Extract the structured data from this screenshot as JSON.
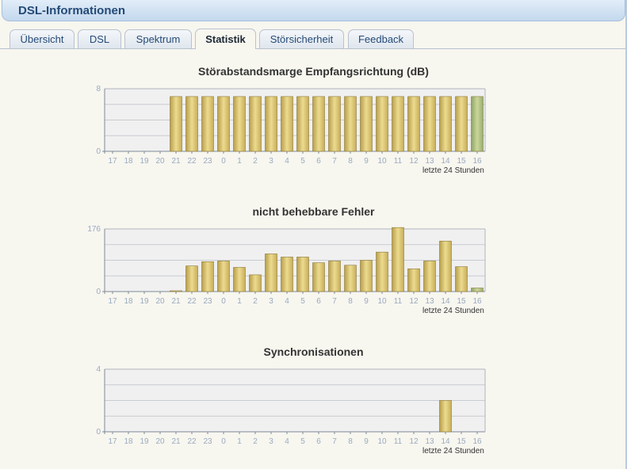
{
  "window": {
    "title": "DSL-Informationen"
  },
  "tabs": [
    {
      "label": "Übersicht",
      "active": false
    },
    {
      "label": "DSL",
      "active": false
    },
    {
      "label": "Spektrum",
      "active": false
    },
    {
      "label": "Statistik",
      "active": true
    },
    {
      "label": "Störsicherheit",
      "active": false
    },
    {
      "label": "Feedback",
      "active": false
    }
  ],
  "colors": {
    "bar": "#d8c166",
    "bar_last": "#a8b878",
    "axis_text": "#9aabc0",
    "plot_bg": "#f0f0f0",
    "grid": "#c8cbd2"
  },
  "chart_data": [
    {
      "type": "bar",
      "title": "Störabstandsmarge Empfangsrichtung (dB)",
      "categories": [
        "17",
        "18",
        "19",
        "20",
        "21",
        "22",
        "23",
        "0",
        "1",
        "2",
        "3",
        "4",
        "5",
        "6",
        "7",
        "8",
        "9",
        "10",
        "11",
        "12",
        "13",
        "14",
        "15",
        "16"
      ],
      "values": [
        0,
        0,
        0,
        0,
        7,
        7,
        7,
        7,
        7,
        7,
        7,
        7,
        7,
        7,
        7,
        7,
        7,
        7,
        7,
        7,
        7,
        7,
        7,
        7
      ],
      "ylim": [
        0,
        8
      ],
      "yticks": [
        "8",
        "0"
      ],
      "caption": "letzte 24 Stunden",
      "last_highlighted": true
    },
    {
      "type": "bar",
      "title": "nicht behebbare Fehler",
      "categories": [
        "17",
        "18",
        "19",
        "20",
        "21",
        "22",
        "23",
        "0",
        "1",
        "2",
        "3",
        "4",
        "5",
        "6",
        "7",
        "8",
        "9",
        "10",
        "11",
        "12",
        "13",
        "14",
        "15",
        "16"
      ],
      "values": [
        0,
        0,
        0,
        0,
        2,
        72,
        84,
        86,
        68,
        47,
        106,
        97,
        97,
        81,
        86,
        74,
        88,
        111,
        180,
        64,
        86,
        142,
        70,
        10
      ],
      "ylim": [
        0,
        176
      ],
      "yticks": [
        "176",
        "0"
      ],
      "caption": "letzte 24 Stunden",
      "last_highlighted": true
    },
    {
      "type": "bar",
      "title": "Synchronisationen",
      "categories": [
        "17",
        "18",
        "19",
        "20",
        "21",
        "22",
        "23",
        "0",
        "1",
        "2",
        "3",
        "4",
        "5",
        "6",
        "7",
        "8",
        "9",
        "10",
        "11",
        "12",
        "13",
        "14",
        "15",
        "16"
      ],
      "values": [
        0,
        0,
        0,
        0,
        0,
        0,
        0,
        0,
        0,
        0,
        0,
        0,
        0,
        0,
        0,
        0,
        0,
        0,
        0,
        0,
        0,
        2,
        0,
        0
      ],
      "ylim": [
        0,
        4
      ],
      "yticks": [
        "4",
        "0"
      ],
      "caption": "letzte 24 Stunden",
      "last_highlighted": false
    }
  ]
}
